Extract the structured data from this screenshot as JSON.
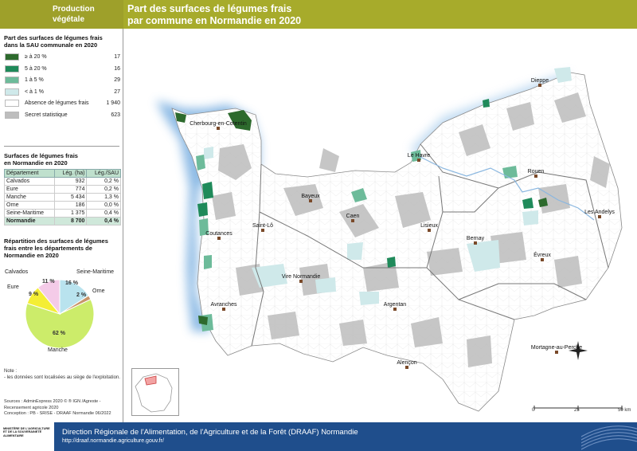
{
  "header": {
    "theme": "Production végétale",
    "title_line1": "Part des surfaces de légumes frais",
    "title_line2": "par commune en Normandie en 2020"
  },
  "legend": {
    "title_line1": "Part des surfaces de légumes frais",
    "title_line2": "dans la SAU communale en 2020",
    "classes": [
      {
        "label": "≥ à 20 %",
        "count": "17",
        "color": "#2d6a2d"
      },
      {
        "label": "5 à 20 %",
        "count": "16",
        "color": "#1f8a5a"
      },
      {
        "label": "1 à 5 %",
        "count": "29",
        "color": "#6dbb9a"
      },
      {
        "label": "< à 1 %",
        "count": "27",
        "color": "#cfe9ea"
      },
      {
        "label": "Absence de légumes frais",
        "count": "1 940",
        "color": "#ffffff"
      },
      {
        "label": "Secret statistique",
        "count": "623",
        "color": "#bdbdbd"
      }
    ]
  },
  "table": {
    "title_line1": "Surfaces de légumes frais",
    "title_line2": "en Normandie en 2020",
    "headers": [
      "Département",
      "Lég. (ha)",
      "Lég./SAU"
    ],
    "rows": [
      [
        "Calvados",
        "932",
        "0,2 %"
      ],
      [
        "Eure",
        "774",
        "0,2 %"
      ],
      [
        "Manche",
        "5 434",
        "1,3 %"
      ],
      [
        "Orne",
        "186",
        "0,0 %"
      ],
      [
        "Seine-Maritime",
        "1 375",
        "0,4 %"
      ],
      [
        "Normandie",
        "8 700",
        "0,4 %"
      ]
    ]
  },
  "pie": {
    "title_line1": "Répartition des surfaces de légumes",
    "title_line2": "frais entre les départements de",
    "title_line3": "Normandie en 2020"
  },
  "chart_data": {
    "type": "pie",
    "categories": [
      "Seine-Maritime",
      "Orne",
      "Manche",
      "Eure",
      "Calvados"
    ],
    "values": [
      16,
      2,
      62,
      9,
      11
    ],
    "labels": [
      "16 %",
      "2 %",
      "62 %",
      "9 %",
      "11 %"
    ],
    "colors": [
      "#b9e3ee",
      "#c8956a",
      "#ccec6a",
      "#f4ee35",
      "#f4cbe8"
    ]
  },
  "note": {
    "title": "Note :",
    "text": "- les données sont localisées au siège de l'exploitation."
  },
  "sources": {
    "line1": "Sources      : AdminExpress 2020 © ® IGN /Agreste -",
    "line2": "Recensement agricole 2020",
    "line3": "Conception : PB - SRISE - DRAAF Normandie 06/2022"
  },
  "towns": [
    {
      "name": "Cherbourg-en-Cotentin"
    },
    {
      "name": "Dieppe"
    },
    {
      "name": "Le Havre"
    },
    {
      "name": "Rouen"
    },
    {
      "name": "Bayeux"
    },
    {
      "name": "Caen"
    },
    {
      "name": "Lisieux"
    },
    {
      "name": "Saint-Lô"
    },
    {
      "name": "Les Andelys"
    },
    {
      "name": "Coutances"
    },
    {
      "name": "Bernay"
    },
    {
      "name": "Évreux"
    },
    {
      "name": "Vire Normandie"
    },
    {
      "name": "Avranches"
    },
    {
      "name": "Argentan"
    },
    {
      "name": "Mortagne-au-Perche"
    },
    {
      "name": "Alençon"
    }
  ],
  "scale": {
    "labels": [
      "0",
      "25",
      "50 km"
    ]
  },
  "footer": {
    "logo_text": "MINISTÈRE DE L'AGRICULTURE ET DE LA SOUVERAINETÉ ALIMENTAIRE",
    "name": "Direction Régionale de l'Alimentation, de l'Agriculture et de la Forêt (DRAAF) Normandie",
    "url": "http://draaf.normandie.agriculture.gouv.fr/"
  }
}
